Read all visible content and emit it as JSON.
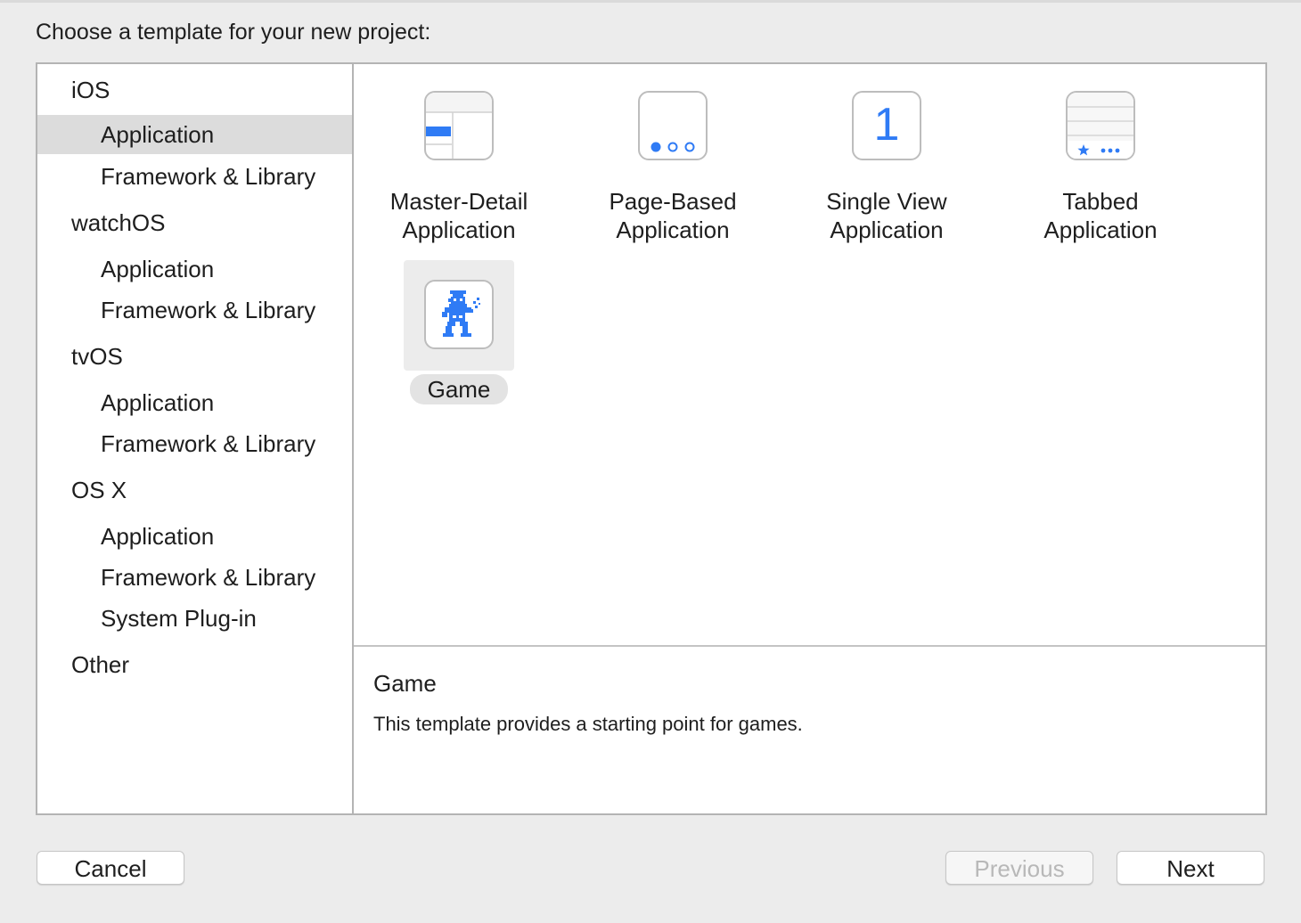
{
  "dialog": {
    "heading": "Choose a template for your new project:"
  },
  "sidebar": {
    "sections": [
      {
        "title": "iOS",
        "items": [
          "Application",
          "Framework & Library"
        ]
      },
      {
        "title": "watchOS",
        "items": [
          "Application",
          "Framework & Library"
        ]
      },
      {
        "title": "tvOS",
        "items": [
          "Application",
          "Framework & Library"
        ]
      },
      {
        "title": "OS X",
        "items": [
          "Application",
          "Framework & Library",
          "System Plug-in"
        ]
      },
      {
        "title": "Other",
        "items": []
      }
    ],
    "selected": "iOS / Application"
  },
  "templates": [
    {
      "line1": "Master-Detail",
      "line2": "Application",
      "icon": "master-detail-icon"
    },
    {
      "line1": "Page-Based",
      "line2": "Application",
      "icon": "page-dots-icon"
    },
    {
      "line1": "Single View",
      "line2": "Application",
      "icon": "number-one-icon",
      "glyph": "1"
    },
    {
      "line1": "Tabbed",
      "line2": "Application",
      "icon": "tab-bar-icon"
    },
    {
      "line1": "Game",
      "icon": "game-character-icon",
      "selected": true
    }
  ],
  "description": {
    "title": "Game",
    "text": "This template provides a starting point for games."
  },
  "buttons": {
    "cancel": "Cancel",
    "previous": "Previous",
    "next": "Next"
  },
  "colors": {
    "accent": "#2f7bf5",
    "selection": "#dcdcdc",
    "border": "#b4b4b4"
  }
}
